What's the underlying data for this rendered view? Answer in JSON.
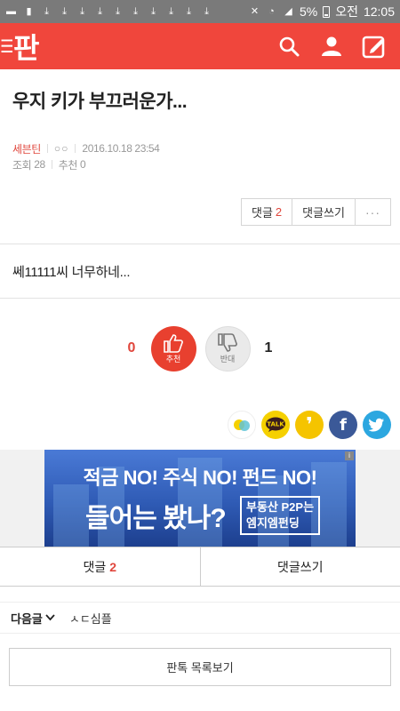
{
  "status_bar": {
    "battery": "5%",
    "ampm": "오전",
    "time": "12:05",
    "icons": [
      "chat-icon",
      "notification-icon",
      "download-icon",
      "download-icon",
      "download-icon",
      "download-icon",
      "download-icon",
      "download-icon",
      "download-icon",
      "download-icon",
      "download-icon",
      "download-icon",
      "mute-icon",
      "wifi-icon",
      "signal-icon"
    ]
  },
  "header": {
    "logo": "판",
    "colors": {
      "brand": "#f0463c"
    }
  },
  "article": {
    "title": "우지 키가 부끄러운가...",
    "author": "세븐틴",
    "author_age": "○○",
    "datetime": "2016.10.18 23:54",
    "views_label": "조회",
    "views": "28",
    "recommend_label": "추천",
    "recommend": "0",
    "body": "쎄11111씨 너무하네..."
  },
  "actions": {
    "comment_label": "댓글",
    "comment_count": "2",
    "write_comment_label": "댓글쓰기",
    "more_label": "···"
  },
  "vote": {
    "up_count": "0",
    "up_label": "추천",
    "down_label": "반대",
    "down_count": "1"
  },
  "share": [
    "kakaostory-icon",
    "kakaotalk-icon",
    "kakaostory-yellow-icon",
    "facebook-icon",
    "twitter-icon"
  ],
  "ad": {
    "line1": "적금 NO! 주식 NO! 펀드 NO!",
    "line2": "들어는 봤나?",
    "box_line1": "부동산 P2P는",
    "box_line2": "엠지엠펀딩"
  },
  "comment_bar": {
    "comments_label": "댓글",
    "comments_count": "2",
    "write_label": "댓글쓰기"
  },
  "next_post": {
    "label": "다음글",
    "title": "ㅅㄷ심플"
  },
  "list_button": "판톡 목록보기"
}
